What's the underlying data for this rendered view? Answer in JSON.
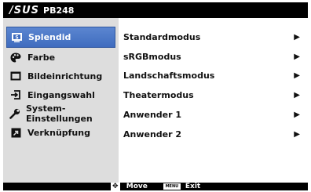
{
  "header": {
    "brand": "/SUS",
    "model": "PB248"
  },
  "sidebar": {
    "items": [
      {
        "label": "Splendid",
        "icon": "splendid-icon",
        "active": true
      },
      {
        "label": "Farbe",
        "icon": "palette-icon",
        "active": false
      },
      {
        "label": "Bildeinrichtung",
        "icon": "image-setup-icon",
        "active": false
      },
      {
        "label": "Eingangswahl",
        "icon": "input-select-icon",
        "active": false
      },
      {
        "label": "System-Einstellungen",
        "icon": "wrench-icon",
        "active": false
      },
      {
        "label": "Verknüpfung",
        "icon": "shortcut-icon",
        "active": false
      }
    ]
  },
  "main": {
    "options": [
      {
        "label": "Standardmodus"
      },
      {
        "label": "sRGBmodus"
      },
      {
        "label": "Landschaftsmodus"
      },
      {
        "label": "Theatermodus"
      },
      {
        "label": "Anwender 1"
      },
      {
        "label": "Anwender 2"
      }
    ],
    "arrow_icon": "triangle-right-icon"
  },
  "footer": {
    "move_label": "Move",
    "menu_key": "MENU",
    "exit_label": "Exit"
  },
  "colors": {
    "active_bg": "#4a78c8",
    "sidebar_bg": "#dddddd",
    "frame": "#000000"
  }
}
